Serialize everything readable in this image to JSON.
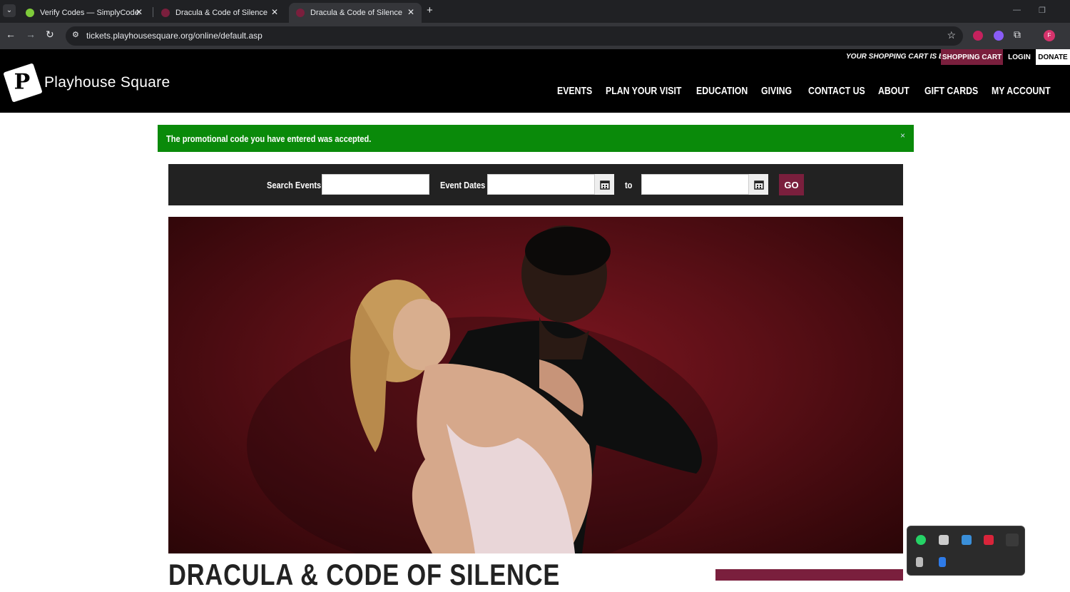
{
  "browser": {
    "tabs": [
      {
        "title": "Verify Codes — SimplyCodes",
        "active": false,
        "favicon_color": "#7ecb3a"
      },
      {
        "title": "Dracula & Code of Silence | Pla",
        "active": false,
        "favicon_color": "#7a1f3d"
      },
      {
        "title": "Dracula & Code of Silence",
        "active": true,
        "favicon_color": "#7a1f3d"
      }
    ],
    "new_tab": "+",
    "url": "tickets.playhousesquare.org/online/default.asp",
    "profile_initial": "F"
  },
  "site": {
    "logo_text": "Playhouse Square",
    "logo_mark": "P",
    "cart_status": "YOUR SHOPPING CART IS EMPTY.",
    "shopping_cart": "SHOPPING CART",
    "login": "LOGIN",
    "donate": "DONATE",
    "nav": [
      "EVENTS",
      "PLAN YOUR VISIT",
      "EDUCATION",
      "GIVING",
      "CONTACT US",
      "ABOUT",
      "GIFT CARDS",
      "MY ACCOUNT"
    ],
    "accent": "#7a1f3d"
  },
  "alert": {
    "text": "The promotional code you have entered was accepted.",
    "close": "×",
    "color": "#0a8a0a"
  },
  "search": {
    "search_label": "Search Events",
    "search_value": "",
    "dates_label": "Event Dates",
    "start_date": "",
    "to_label": "to",
    "end_date": "",
    "go": "GO"
  },
  "event": {
    "title": "DRACULA & CODE OF SILENCE"
  }
}
